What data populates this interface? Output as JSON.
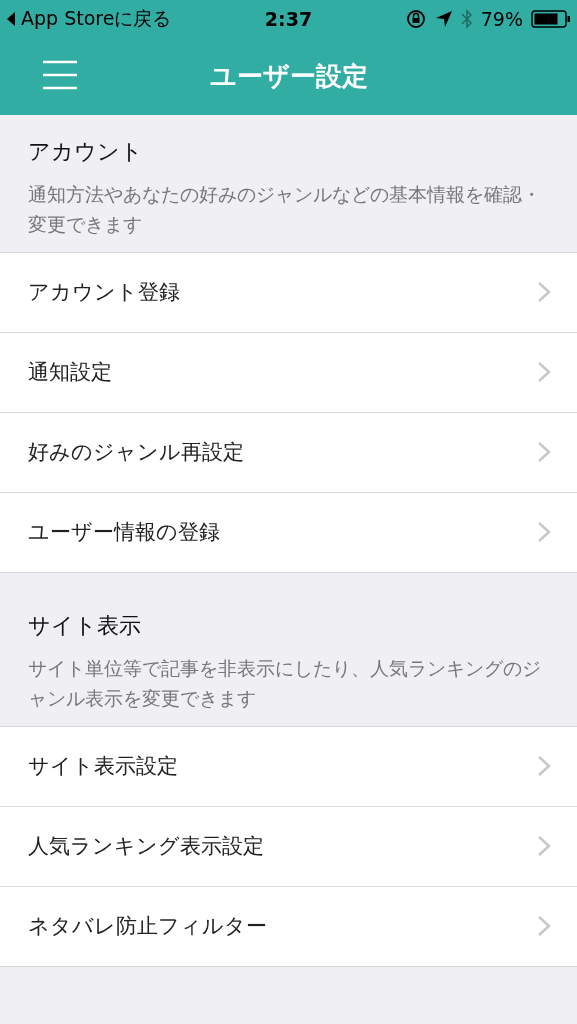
{
  "status_bar": {
    "back": "App Storeに戻る",
    "time": "2:37",
    "battery": "79%"
  },
  "nav": {
    "title": "ユーザー設定"
  },
  "sections": [
    {
      "title": "アカウント",
      "description": "通知方法やあなたの好みのジャンルなどの基本情報を確認・変更できます",
      "items": [
        "アカウント登録",
        "通知設定",
        "好みのジャンル再設定",
        "ユーザー情報の登録"
      ]
    },
    {
      "title": "サイト表示",
      "description": "サイト単位等で記事を非表示にしたり、人気ランキングのジャンル表示を変更できます",
      "items": [
        "サイト表示設定",
        "人気ランキング表示設定",
        "ネタバレ防止フィルター"
      ]
    }
  ]
}
